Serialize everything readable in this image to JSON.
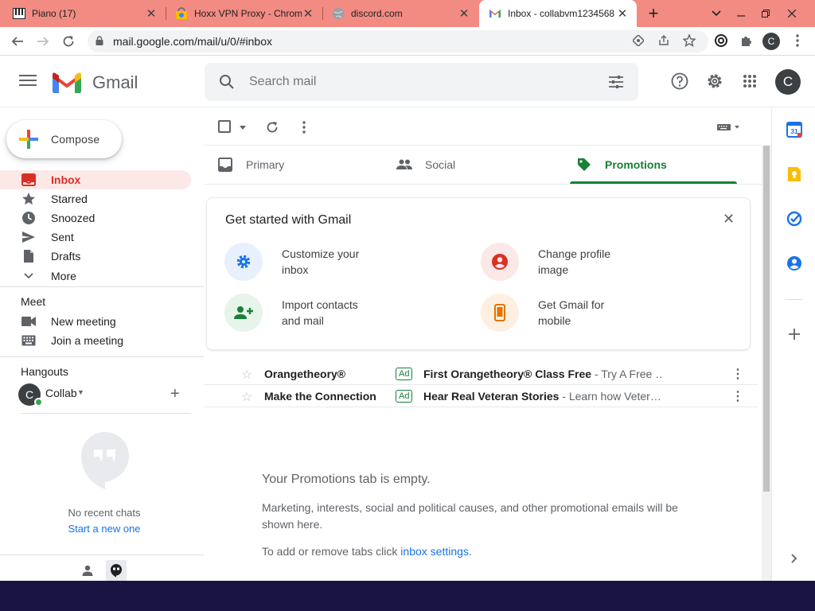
{
  "browser": {
    "tabs": [
      {
        "title": "Piano (17)",
        "icon": "piano-favicon"
      },
      {
        "title": "Hoxx VPN Proxy - Chrom",
        "icon": "chrome-web-store-favicon"
      },
      {
        "title": "discord.com",
        "icon": "globe-favicon"
      },
      {
        "title": "Inbox - collabvm1234568",
        "icon": "gmail-favicon"
      }
    ],
    "close_glyph": "✕",
    "new_tab_glyph": "+",
    "url": "mail.google.com/mail/u/0/#inbox",
    "profile_initial": "C"
  },
  "header": {
    "app_name": "Gmail",
    "search_placeholder": "Search mail",
    "avatar_initial": "C"
  },
  "sidebar": {
    "compose_label": "Compose",
    "items": [
      {
        "label": "Inbox",
        "icon": "inbox-icon",
        "active": true
      },
      {
        "label": "Starred",
        "icon": "star-icon"
      },
      {
        "label": "Snoozed",
        "icon": "clock-icon"
      },
      {
        "label": "Sent",
        "icon": "send-icon"
      },
      {
        "label": "Drafts",
        "icon": "draft-icon"
      },
      {
        "label": "More",
        "icon": "chevron-down-icon"
      }
    ],
    "meet": {
      "title": "Meet",
      "items": [
        {
          "label": "New meeting",
          "icon": "video-camera-icon"
        },
        {
          "label": "Join a meeting",
          "icon": "keyboard-icon"
        }
      ]
    },
    "hangouts": {
      "title": "Hangouts",
      "user_initial": "C",
      "user_name": "Collab",
      "no_chats": "No recent chats",
      "start_new": "Start a new one"
    }
  },
  "tabs": [
    {
      "label": "Primary",
      "icon": "inbox-tray-icon"
    },
    {
      "label": "Social",
      "icon": "people-icon"
    },
    {
      "label": "Promotions",
      "icon": "tag-icon",
      "active": true
    }
  ],
  "getting_started": {
    "title": "Get started with Gmail",
    "features": [
      {
        "line1": "Customize your",
        "line2": "inbox",
        "icon": "gear-icon"
      },
      {
        "line1": "Change profile",
        "line2": "image",
        "icon": "account-circle-icon"
      },
      {
        "line1": "Import contacts",
        "line2": "and mail",
        "icon": "person-add-icon"
      },
      {
        "line1": "Get Gmail for",
        "line2": "mobile",
        "icon": "smartphone-icon"
      }
    ]
  },
  "ads": [
    {
      "sender": "Orangetheory®",
      "badge": "Ad",
      "subject": "First Orangetheory® Class Free",
      "snippet": " - Try A Free …"
    },
    {
      "sender": "Make the Connection",
      "badge": "Ad",
      "subject": "Hear Real Veteran Stories",
      "snippet": " - Learn how Veter…"
    }
  ],
  "empty_state": {
    "title": "Your Promotions tab is empty.",
    "description": "Marketing, interests, social and political causes, and other promotional emails will be shown here.",
    "hint_prefix": "To add or remove tabs click ",
    "hint_link": "inbox settings",
    "hint_suffix": "."
  },
  "colors": {
    "tabbar": "#f28b82",
    "active_nav": "#fce8e6",
    "accent_red": "#d93025",
    "promotions_green": "#188038",
    "link_blue": "#1a73e8",
    "taskbar": "#1a1443"
  }
}
